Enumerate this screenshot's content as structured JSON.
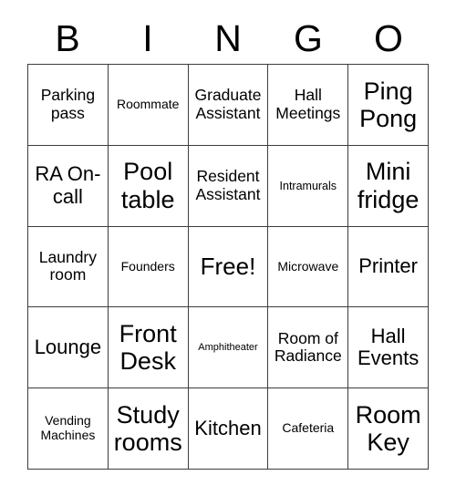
{
  "card": {
    "title": "BINGO",
    "header_letters": [
      "B",
      "I",
      "N",
      "G",
      "O"
    ],
    "free_space_label": "Free!",
    "free_space_position": {
      "row": 3,
      "column": 3
    },
    "grid_size": "5x5",
    "colors": {
      "background": "#ffffff",
      "text": "#000000",
      "grid_line": "#3d3d3d"
    },
    "rows": [
      [
        {
          "label": "Parking pass",
          "size": "md"
        },
        {
          "label": "Roommate",
          "size": "sm"
        },
        {
          "label": "Graduate Assistant",
          "size": "md"
        },
        {
          "label": "Hall Meetings",
          "size": "md"
        },
        {
          "label": "Ping Pong",
          "size": "xxl"
        }
      ],
      [
        {
          "label": "RA On-call",
          "size": "lg"
        },
        {
          "label": "Pool table",
          "size": "xxl"
        },
        {
          "label": "Resident Assistant",
          "size": "md"
        },
        {
          "label": "Intramurals",
          "size": "xs"
        },
        {
          "label": "Mini fridge",
          "size": "xxl"
        }
      ],
      [
        {
          "label": "Laundry room",
          "size": "md"
        },
        {
          "label": "Founders",
          "size": "sm"
        },
        {
          "label": "Free!",
          "size": "xl"
        },
        {
          "label": "Microwave",
          "size": "sm"
        },
        {
          "label": "Printer",
          "size": "lg"
        }
      ],
      [
        {
          "label": "Lounge",
          "size": "lg"
        },
        {
          "label": "Front Desk",
          "size": "xxl"
        },
        {
          "label": "Amphitheater",
          "size": "xxs"
        },
        {
          "label": "Room of Radiance",
          "size": "md"
        },
        {
          "label": "Hall Events",
          "size": "lg"
        }
      ],
      [
        {
          "label": "Vending Machines",
          "size": "sm"
        },
        {
          "label": "Study rooms",
          "size": "xxl"
        },
        {
          "label": "Kitchen",
          "size": "lg"
        },
        {
          "label": "Cafeteria",
          "size": "sm"
        },
        {
          "label": "Room Key",
          "size": "xxl"
        }
      ]
    ]
  }
}
